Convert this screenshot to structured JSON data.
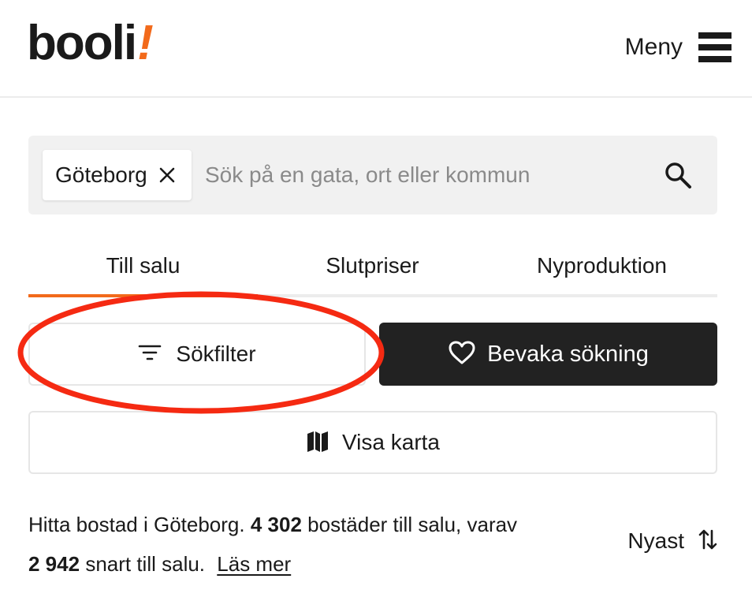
{
  "header": {
    "logo_text": "booli",
    "logo_mark": "!",
    "menu_label": "Meny",
    "menu_icon": "hamburger-icon",
    "brand_color": "#f26a1b"
  },
  "search": {
    "chip_label": "Göteborg",
    "chip_close_icon": "close-icon",
    "placeholder": "Sök på en gata, ort eller kommun",
    "search_icon": "search-icon"
  },
  "tabs": [
    {
      "label": "Till salu",
      "active": true
    },
    {
      "label": "Slutpriser",
      "active": false
    },
    {
      "label": "Nyproduktion",
      "active": false
    }
  ],
  "actions": {
    "filter_label": "Sökfilter",
    "filter_icon": "filter-lines-icon",
    "watch_label": "Bevaka sökning",
    "watch_icon": "heart-icon",
    "map_label": "Visa karta",
    "map_icon": "map-icon"
  },
  "annotation": {
    "shape": "ellipse",
    "color": "#f52a12"
  },
  "summary": {
    "text_1": "Hitta bostad i Göteborg.",
    "count_for_sale": "4 302",
    "text_2": "bostäder till salu, varav",
    "count_soon": "2 942",
    "text_3": "snart till salu.",
    "read_more": "Läs mer"
  },
  "sort": {
    "label": "Nyast",
    "icon": "sort-arrows-icon"
  }
}
